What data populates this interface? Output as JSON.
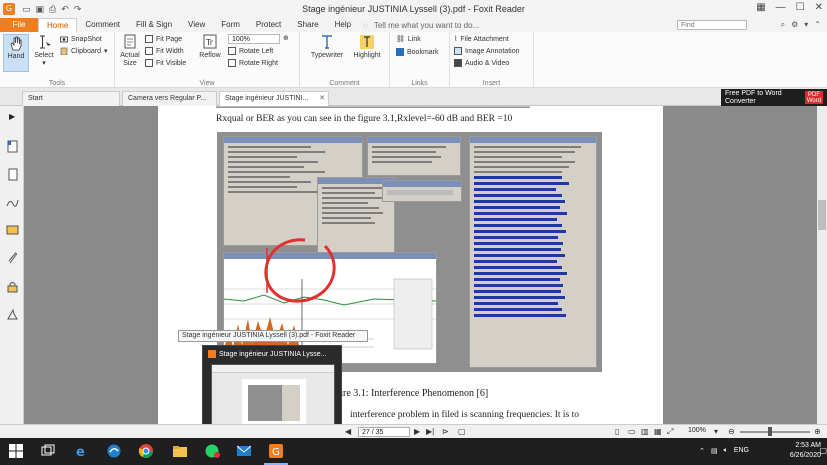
{
  "window": {
    "title": "Stage ingénieur JUSTINIA Lyssell (3).pdf - Foxit Reader"
  },
  "menu": {
    "file": "File",
    "tabs": [
      "Home",
      "Comment",
      "Fill & Sign",
      "View",
      "Form",
      "Protect",
      "Share",
      "Help"
    ],
    "tell_me": "Tell me what you want to do...",
    "find_placeholder": "Find"
  },
  "ribbon": {
    "tools": {
      "label": "Tools",
      "hand": "Hand",
      "select": "Select",
      "snapshot": "SnapShot",
      "clipboard": "Clipboard"
    },
    "view": {
      "label": "View",
      "actual_size": "Actual Size",
      "fit_page": "Fit Page",
      "fit_width": "Fit Width",
      "fit_visible": "Fit Visible",
      "reflow": "Reflow",
      "zoom": "100%",
      "rotate_left": "Rotate Left",
      "rotate_right": "Rotate Right"
    },
    "comment": {
      "label": "Comment",
      "typewriter": "Typewriter",
      "highlight": "Highlight"
    },
    "links": {
      "label": "Links",
      "link": "Link",
      "bookmark": "Bookmark"
    },
    "insert": {
      "label": "Insert",
      "file_attachment": "File Attachment",
      "image_annotation": "Image Annotation",
      "audio_video": "Audio & Video"
    }
  },
  "doc_tabs": [
    {
      "label": "Start"
    },
    {
      "label": "Camera vers Regular P..."
    },
    {
      "label": "Stage ingénieur JUSTINI..."
    }
  ],
  "promo": {
    "line1": "Free PDF to Word",
    "line2": "Converter",
    "badge_top": "PDF",
    "badge_bottom": "Word"
  },
  "page": {
    "top_line": "Rxqual or BER as you can see in the figure 3.1,Rxlevel=-60 dB and BER =10",
    "caption": "ure 3.1: Interference Phenomenon [6]",
    "body_line": "interference problem in filed is scanning frequencies. It is to"
  },
  "taskbar_preview": {
    "tooltip": "Stage ingénieur JUSTINIA Lyssell (3).pdf - Foxit Reader",
    "title": "Stage ingénieur JUSTINIA Lysse..."
  },
  "status": {
    "page_indicator": "27 / 35",
    "zoom": "100%"
  },
  "tray": {
    "lang": "ENG",
    "time": "2:53 AM",
    "date": "6/26/2020"
  },
  "colors": {
    "accent": "#ef7d22",
    "taskbar": "#1f1f1f",
    "annotation_red": "#e03030"
  }
}
